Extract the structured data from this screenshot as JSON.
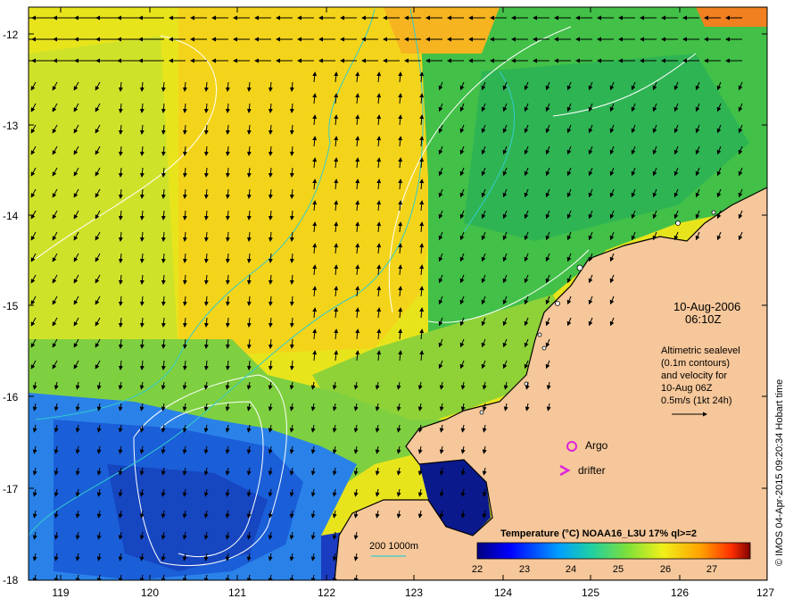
{
  "date_line": "10-Aug-2006",
  "time_line": "06:10Z",
  "info_lines": [
    "Altimetric sealevel",
    "(0.1m contours)",
    "and velocity for",
    "10-Aug 06Z",
    "0.5m/s (1kt 24h)"
  ],
  "legend": {
    "argo_label": "Argo",
    "drifter_label": "drifter",
    "argo_color": "#dd22dd",
    "drifter_color": "#dd22dd"
  },
  "isobath_label": "200  1000m",
  "isobath_color": "#33cccc",
  "colorbar": {
    "title": "Temperature (°C) NOAA16_L3U 17% ql>=2",
    "ticks": [
      "22",
      "23",
      "24",
      "25",
      "26",
      "27"
    ]
  },
  "x_ticks": [
    "119",
    "120",
    "121",
    "122",
    "123",
    "124",
    "125",
    "126",
    "127"
  ],
  "y_ticks": [
    "-12",
    "-13",
    "-14",
    "-15",
    "-16",
    "-17",
    "-18"
  ],
  "credit": "© IMOS 04-Apr-2015 09:20:34 Hobart time",
  "colors": {
    "land": "#f6c79a",
    "warm_sst": "#f2e21c",
    "mid_sst": "#3cbe3c",
    "cool_sst": "#1a5ed8",
    "coldest_sst": "#0a1a8c",
    "contour": "#ffffff",
    "vectors": "#000000"
  }
}
